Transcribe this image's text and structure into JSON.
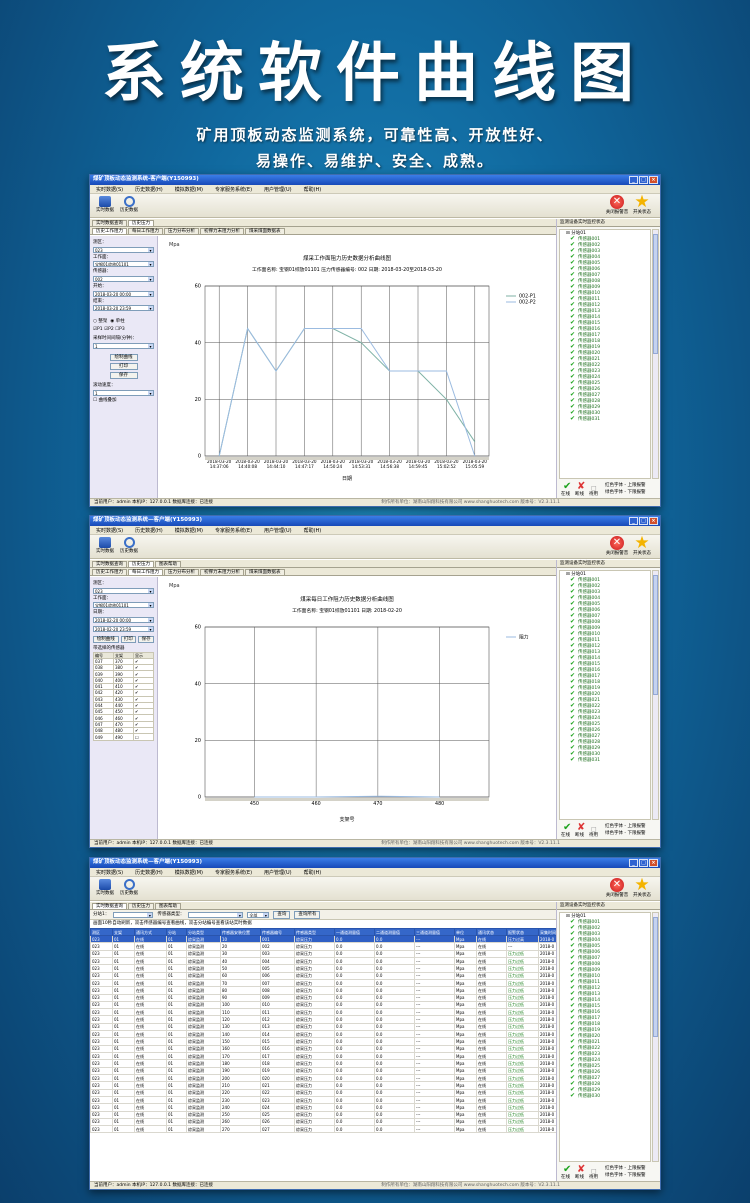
{
  "header": {
    "title": "系统软件曲线图",
    "subtitle_line1": "矿用顶板动态监测系统，可靠性高、开放性好、",
    "subtitle_line2": "易操作、易维护、安全、成熟。"
  },
  "window": {
    "title": "煤矿顶板动态监测系统-客户端(Y150993)",
    "title_lower": "煤矿顶板动态监测系统—客户端(Y150993)",
    "menu": [
      "实时数据(S)",
      "历史数据(H)",
      "模拟数据(M)",
      "专家服务系统(E)",
      "用户管理(U)",
      "帮助(H)"
    ],
    "toolbar": {
      "realtime": "实时数据",
      "history": "历史数据",
      "alarm_off": "关闭报警音",
      "open_status": "开关状态"
    },
    "status": {
      "user": "当前用户：admin  本机IP：127.0.0.1  数据库连接：已连接",
      "company": "制作所有单位：湖南山阳翔科技有限公司 www.shanghuotech.com  版本号：V2.3.11.1"
    }
  },
  "right_panel": {
    "title": "监测设备实时监控状态",
    "root": "分站01",
    "sensor_prefix": "传感器",
    "legend": {
      "online": "在线",
      "offline": "断线",
      "pressure_alarm_up": "红色字体 - 上限报警",
      "pressure_alarm_low": "绿色字体 - 下限报警",
      "pending": "待用"
    }
  },
  "screens": [
    {
      "top_tabs": [
        "实时数据查询",
        "历史压力"
      ],
      "sub_tabs": [
        "历史工作阻力",
        "每日工作阻力",
        "压力分布分析",
        "初撑力末阻力分析",
        "煤采煤面数据表"
      ],
      "panel": {
        "labels": {
          "mine": "测区：",
          "face": "工作面：",
          "sensor": "传感器：",
          "start": "开始：",
          "end": "结束：",
          "mode_whole": "整架",
          "mode_single": "单柱",
          "p1": "P1",
          "p2": "P2",
          "p3": "P3",
          "interval": "采样时间间隔(分钟)：",
          "draw": "绘制曲线",
          "print": "打印",
          "save": "保存",
          "scroll_speed": "滚动速度：",
          "overlay": "曲线叠加"
        },
        "values": {
          "mine": "023",
          "face": "宝钢01综放01101",
          "sensor": "002",
          "start": "2018-03-20 00:00",
          "end": "2018-03-20 23:59",
          "interval": "1",
          "scroll_speed": "1"
        }
      },
      "chart_text": {
        "unit": "Mpa",
        "title": "煤采工作面阻力历史数据分析曲线图",
        "subtitle": "工作面名称: 宝钢01综放01101   压力传感器编号: 002   日期: 2018-03-20至2018-03-20",
        "xlabel": "日期"
      }
    },
    {
      "top_tabs": [
        "实时数据查询",
        "历史压力",
        "图表帮助"
      ],
      "sub_tabs": [
        "历史工作阻力",
        "每日工作阻力",
        "压力分布分析",
        "初撑力末阻力分析",
        "煤采煤面数据表"
      ],
      "panel": {
        "labels": {
          "mine": "测区：",
          "face": "工作面：",
          "date": "日期：",
          "draw": "绘制曲线",
          "print": "打印",
          "save": "保存",
          "table_title": "带选择的传感器",
          "col1": "编号",
          "col2": "支架",
          "col3": "显示"
        },
        "values": {
          "mine": "023",
          "face": "宝钢01综放01101",
          "start": "2018-02-20 00:00",
          "end": "2018-02-20 23:59"
        },
        "sensor_rows": [
          [
            "037",
            "370",
            "✔"
          ],
          [
            "038",
            "380",
            "✔"
          ],
          [
            "039",
            "390",
            "✔"
          ],
          [
            "040",
            "400",
            "✔"
          ],
          [
            "041",
            "410",
            "✔"
          ],
          [
            "042",
            "420",
            "✔"
          ],
          [
            "043",
            "430",
            "✔"
          ],
          [
            "044",
            "440",
            "✔"
          ],
          [
            "045",
            "450",
            "✔"
          ],
          [
            "046",
            "460",
            "✔"
          ],
          [
            "047",
            "470",
            "✔"
          ],
          [
            "048",
            "480",
            "✔"
          ],
          [
            "049",
            "490",
            "☐"
          ]
        ]
      },
      "chart_text": {
        "unit": "Mpa",
        "title": "煤采每日工作阻力历史数据分析曲线图",
        "subtitle": "工作面名称: 宝钢01综放01101   日期: 2018-02-20",
        "xlabel": "支架号"
      }
    },
    {
      "top_tabs": [
        "实时数据查询",
        "历史压力",
        "图表帮助"
      ],
      "query": {
        "station_label": "分站1：",
        "sensor_label": "传感器类型：",
        "state_value": "全部",
        "query_btn": "查询",
        "clear_btn": "查询所有"
      },
      "note": "画面10秒自动刷新，双击传感器编号查看曲线，双击分站编号查看该站实时数据",
      "columns": [
        "测区",
        "支架",
        "通讯方式",
        "分站",
        "分站类型",
        "传感器安装位置",
        "传感器编号",
        "传感器类型",
        "一通道测量值",
        "二通道测量值",
        "三通道测量值",
        "单位",
        "通讯状态",
        "报警状态",
        "采集时间"
      ],
      "rows": [
        [
          "023",
          "01",
          "在线",
          "01",
          "综采监测",
          "10",
          "001",
          "综采压力",
          "0.0",
          "0.0",
          "---",
          "Mpa",
          "在线",
          "压力过高",
          "2018-0"
        ],
        [
          "023",
          "01",
          "在线",
          "01",
          "综采监测",
          "20",
          "002",
          "综采压力",
          "0.0",
          "0.0",
          "---",
          "Mpa",
          "在线",
          "---",
          "2018-0"
        ],
        [
          "023",
          "01",
          "在线",
          "01",
          "综采监测",
          "30",
          "003",
          "综采压力",
          "0.0",
          "0.0",
          "---",
          "Mpa",
          "在线",
          "压力过低",
          "2018-0"
        ],
        [
          "023",
          "01",
          "在线",
          "01",
          "综采监测",
          "40",
          "004",
          "综采压力",
          "0.0",
          "0.0",
          "---",
          "Mpa",
          "在线",
          "压力过低",
          "2018-0"
        ],
        [
          "023",
          "01",
          "在线",
          "01",
          "综采监测",
          "50",
          "005",
          "综采压力",
          "0.0",
          "0.0",
          "---",
          "Mpa",
          "在线",
          "压力过低",
          "2018-0"
        ],
        [
          "023",
          "01",
          "在线",
          "01",
          "综采监测",
          "60",
          "006",
          "综采压力",
          "0.0",
          "0.0",
          "---",
          "Mpa",
          "在线",
          "压力过低",
          "2018-0"
        ],
        [
          "023",
          "01",
          "在线",
          "01",
          "综采监测",
          "70",
          "007",
          "综采压力",
          "0.0",
          "0.0",
          "---",
          "Mpa",
          "在线",
          "压力过低",
          "2018-0"
        ],
        [
          "023",
          "01",
          "在线",
          "01",
          "综采监测",
          "80",
          "008",
          "综采压力",
          "0.0",
          "0.0",
          "---",
          "Mpa",
          "在线",
          "压力过低",
          "2018-0"
        ],
        [
          "023",
          "01",
          "在线",
          "01",
          "综采监测",
          "90",
          "009",
          "综采压力",
          "0.0",
          "0.0",
          "---",
          "Mpa",
          "在线",
          "压力过低",
          "2018-0"
        ],
        [
          "023",
          "01",
          "在线",
          "01",
          "综采监测",
          "100",
          "010",
          "综采压力",
          "0.0",
          "0.0",
          "---",
          "Mpa",
          "在线",
          "压力过低",
          "2018-0"
        ],
        [
          "023",
          "01",
          "在线",
          "01",
          "综采监测",
          "110",
          "011",
          "综采压力",
          "0.0",
          "0.0",
          "---",
          "Mpa",
          "在线",
          "压力过低",
          "2018-0"
        ],
        [
          "023",
          "01",
          "在线",
          "01",
          "综采监测",
          "120",
          "012",
          "综采压力",
          "0.0",
          "0.0",
          "---",
          "Mpa",
          "在线",
          "压力过低",
          "2018-0"
        ],
        [
          "023",
          "01",
          "在线",
          "01",
          "综采监测",
          "130",
          "013",
          "综采压力",
          "0.0",
          "0.0",
          "---",
          "Mpa",
          "在线",
          "压力过低",
          "2018-0"
        ],
        [
          "023",
          "01",
          "在线",
          "01",
          "综采监测",
          "140",
          "014",
          "综采压力",
          "0.0",
          "0.0",
          "---",
          "Mpa",
          "在线",
          "压力过低",
          "2018-0"
        ],
        [
          "023",
          "01",
          "在线",
          "01",
          "综采监测",
          "150",
          "015",
          "综采压力",
          "0.0",
          "0.0",
          "---",
          "Mpa",
          "在线",
          "压力过低",
          "2018-0"
        ],
        [
          "023",
          "01",
          "在线",
          "01",
          "综采监测",
          "160",
          "016",
          "综采压力",
          "0.0",
          "0.0",
          "---",
          "Mpa",
          "在线",
          "压力过低",
          "2018-0"
        ],
        [
          "023",
          "01",
          "在线",
          "01",
          "综采监测",
          "170",
          "017",
          "综采压力",
          "0.0",
          "0.0",
          "---",
          "Mpa",
          "在线",
          "压力过低",
          "2018-0"
        ],
        [
          "023",
          "01",
          "在线",
          "01",
          "综采监测",
          "180",
          "018",
          "综采压力",
          "0.0",
          "0.0",
          "---",
          "Mpa",
          "在线",
          "压力过低",
          "2018-0"
        ],
        [
          "023",
          "01",
          "在线",
          "01",
          "综采监测",
          "190",
          "019",
          "综采压力",
          "0.0",
          "0.0",
          "---",
          "Mpa",
          "在线",
          "压力过低",
          "2018-0"
        ],
        [
          "023",
          "01",
          "在线",
          "01",
          "综采监测",
          "200",
          "020",
          "综采压力",
          "0.0",
          "0.0",
          "---",
          "Mpa",
          "在线",
          "压力过低",
          "2018-0"
        ],
        [
          "023",
          "01",
          "在线",
          "01",
          "综采监测",
          "210",
          "021",
          "综采压力",
          "0.0",
          "0.0",
          "---",
          "Mpa",
          "在线",
          "压力过低",
          "2018-0"
        ],
        [
          "023",
          "01",
          "在线",
          "01",
          "综采监测",
          "220",
          "022",
          "综采压力",
          "0.0",
          "0.0",
          "---",
          "Mpa",
          "在线",
          "压力过低",
          "2018-0"
        ],
        [
          "023",
          "01",
          "在线",
          "01",
          "综采监测",
          "230",
          "023",
          "综采压力",
          "0.0",
          "0.0",
          "---",
          "Mpa",
          "在线",
          "压力过低",
          "2018-0"
        ],
        [
          "023",
          "01",
          "在线",
          "01",
          "综采监测",
          "240",
          "024",
          "综采压力",
          "0.0",
          "0.0",
          "---",
          "Mpa",
          "在线",
          "压力过低",
          "2018-0"
        ],
        [
          "023",
          "01",
          "在线",
          "01",
          "综采监测",
          "250",
          "025",
          "综采压力",
          "0.0",
          "0.0",
          "---",
          "Mpa",
          "在线",
          "压力过低",
          "2018-0"
        ],
        [
          "023",
          "01",
          "在线",
          "01",
          "综采监测",
          "260",
          "026",
          "综采压力",
          "0.0",
          "0.0",
          "---",
          "Mpa",
          "在线",
          "压力过低",
          "2018-0"
        ],
        [
          "023",
          "01",
          "在线",
          "01",
          "综采监测",
          "270",
          "027",
          "综采压力",
          "0.0",
          "0.0",
          "---",
          "Mpa",
          "在线",
          "压力过低",
          "2018-0"
        ]
      ]
    }
  ],
  "chart_data": [
    {
      "type": "line",
      "title": "煤采工作面阻力历史数据分析曲线图",
      "xlabel": "日期",
      "ylabel": "Mpa",
      "ylim": [
        0,
        60
      ],
      "categories": [
        "2018-03-20 14:37:06",
        "2018-03-20 14:40:08",
        "2018-03-20 14:44:10",
        "2018-03-20 14:47:17",
        "2018-03-20 14:50:24",
        "2018-03-20 14:53:31",
        "2018-03-20 14:56:38",
        "2018-03-20 14:59:45",
        "2018-03-20 15:02:52",
        "2018-03-20 15:05:59"
      ],
      "series": [
        {
          "name": "002-P1",
          "values": [
            0,
            45,
            30,
            45,
            45,
            40,
            30,
            30,
            20,
            5
          ]
        },
        {
          "name": "002-P2",
          "values": [
            0,
            45,
            30,
            45,
            45,
            45,
            30,
            30,
            30,
            0
          ]
        }
      ],
      "legend": "top-right",
      "grid": true
    },
    {
      "type": "line",
      "title": "煤采每日工作阻力历史数据分析曲线图",
      "xlabel": "支架号",
      "ylabel": "Mpa",
      "ylim": [
        0,
        60
      ],
      "x": [
        450,
        460,
        470,
        480
      ],
      "series": [
        {
          "name": "阻力",
          "values": [
            0,
            0,
            0.3,
            0
          ]
        }
      ],
      "legend": "top-right",
      "grid": true
    }
  ],
  "colors": {
    "accent": "#3567c9",
    "online": "#1fa31f",
    "series1": "#7fb2a6",
    "series2": "#9bbbe0"
  }
}
